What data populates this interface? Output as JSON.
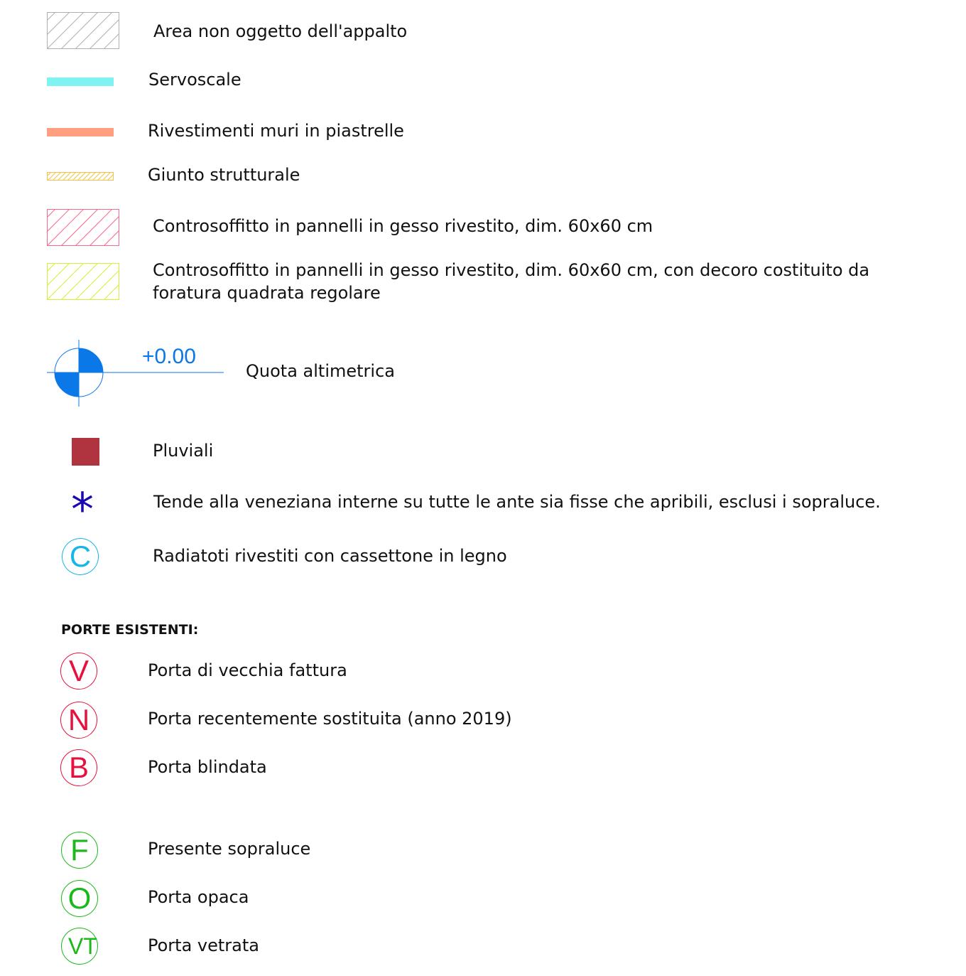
{
  "legend": [
    {
      "label": "Area non oggetto dell'appalto",
      "symbol": "hatch-gray-icon"
    },
    {
      "label": "Servoscale",
      "symbol": "cyan-line-icon"
    },
    {
      "label": "Rivestimenti muri in piastrelle",
      "symbol": "salmon-line-icon"
    },
    {
      "label": "Giunto strutturale",
      "symbol": "hatch-yellow-icon"
    },
    {
      "label": "Controsoffitto in pannelli in gesso rivestito, dim. 60x60 cm",
      "symbol": "hatch-pink-icon"
    },
    {
      "label": "Controsoffitto in pannelli in gesso rivestito, dim. 60x60 cm, con decoro costituito da foratura quadrata regolare",
      "symbol": "hatch-lime-icon"
    },
    {
      "label": "Quota altimetrica",
      "symbol": "elevation-marker-icon",
      "value": "+0.00"
    },
    {
      "label": "Pluviali",
      "symbol": "red-square-icon"
    },
    {
      "label": "Tende alla veneziana interne su tutte le ante sia fisse che apribili, esclusi i sopraluce.",
      "symbol": "asterisk-icon",
      "glyph": "*"
    },
    {
      "label": "Radiatoti rivestiti con cassettone in legno",
      "symbol": "circle-c-icon",
      "letter": "C"
    }
  ],
  "doors_heading": "PORTE ESISTENTI:",
  "doors": [
    {
      "letter": "V",
      "label": "Porta di vecchia fattura"
    },
    {
      "letter": "N",
      "label": "Porta recentemente sostituita (anno 2019)"
    },
    {
      "letter": "B",
      "label": "Porta blindata"
    }
  ],
  "door_types": [
    {
      "letter": "F",
      "label": "Presente sopraluce"
    },
    {
      "letter": "O",
      "label": "Porta opaca"
    },
    {
      "letter": "VT",
      "label": "Porta vetrata"
    }
  ],
  "colors": {
    "gray_hatch": "#b0b0b0",
    "cyan": "#7ff2f2",
    "salmon": "#ff9f80",
    "yellow": "#f2c24a",
    "pink": "#f46a8c",
    "lime": "#d4ef3a",
    "elevation_blue": "#0a78e6",
    "pluviali": "#b03440",
    "asterisk": "#1a08b0",
    "radiator_cyan": "#16b6e8",
    "door_red": "#e8103c",
    "door_green": "#1ab81a"
  }
}
